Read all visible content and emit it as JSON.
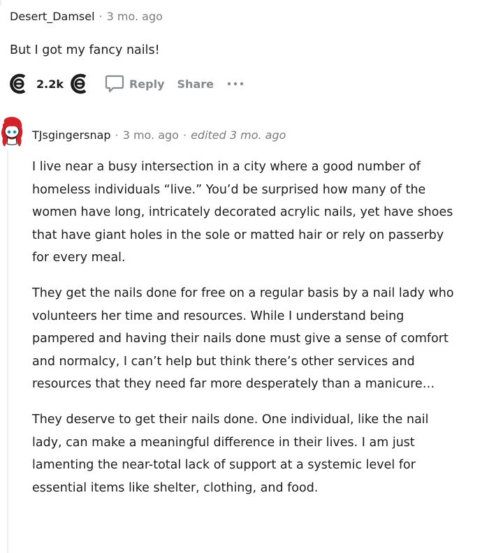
{
  "parent_comment": {
    "username": "Desert_Damsel",
    "time": "3 mo. ago",
    "body": "But I got my fancy nails!",
    "vote_count": "2.2k",
    "reply_label": "Reply",
    "share_label": "Share"
  },
  "reply_comment": {
    "username": "TJsgingersnap",
    "time": "3 mo. ago",
    "edited": "edited 3 mo. ago",
    "paragraphs": [
      "I live near a busy intersection in a city where a good number of homeless individuals “live.” You’d be surprised how many of the women have long, intricately decorated acrylic nails, yet have shoes that have giant holes in the sole or matted hair or rely on passerby for every meal.",
      "They get the nails done for free on a regular basis by a nail lady who volunteers her time and resources. While I understand being pampered and having their nails done must give a sense of comfort and normalcy, I can’t help but think there’s other services and resources that they need far more desperately than a manicure…",
      "They deserve to get their nails done. One individual, like the nail lady, can make a meaningful difference in their lives. I am just lamenting the near-total lack of support at a systemic level for essential items like shelter, clothing, and food."
    ]
  },
  "icons": {
    "upvote": "upvote-icon",
    "downvote": "downvote-icon",
    "reply": "speech-bubble-icon",
    "more": "more-icon",
    "avatar": "snoo-avatar"
  },
  "colors": {
    "text": "#1c1c1c",
    "meta": "#7c7c7c",
    "action": "#878a8c",
    "thread_line": "#eceff1",
    "avatar_hair": "#d2232a"
  }
}
